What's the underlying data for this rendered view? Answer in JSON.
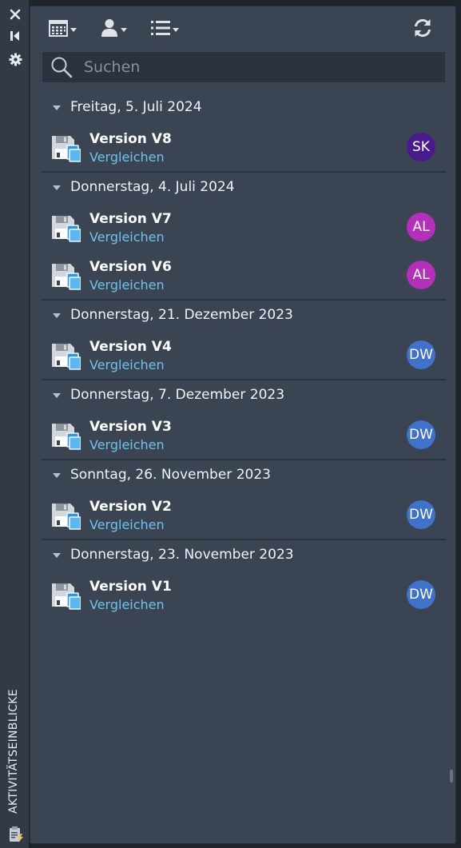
{
  "sidebar": {
    "title": "AKTIVITÄTSEINBLICKE",
    "icons": [
      "close-icon",
      "collapse-icon",
      "gear-icon",
      "clipboard-lightning-icon"
    ]
  },
  "toolbar": {
    "icons": [
      "calendar-filter-icon",
      "user-filter-icon",
      "list-filter-icon",
      "refresh-icon"
    ]
  },
  "search": {
    "placeholder": "Suchen",
    "value": ""
  },
  "colors": {
    "link": "#6fc4ef",
    "avatar_SK": "#4a1a8c",
    "avatar_AL": "#b530b8",
    "avatar_DW": "#3f72c8",
    "panel": "#3b4453"
  },
  "groups": [
    {
      "label": "Freitag, 5. Juli 2024",
      "items": [
        {
          "title": "Version V8",
          "link": "Vergleichen",
          "initials": "SK",
          "avatar_color": "#4a1a8c"
        }
      ]
    },
    {
      "label": "Donnerstag, 4. Juli 2024",
      "items": [
        {
          "title": "Version V7",
          "link": "Vergleichen",
          "initials": "AL",
          "avatar_color": "#b530b8"
        },
        {
          "title": "Version V6",
          "link": "Vergleichen",
          "initials": "AL",
          "avatar_color": "#b530b8"
        }
      ]
    },
    {
      "label": "Donnerstag, 21. Dezember 2023",
      "items": [
        {
          "title": "Version V4",
          "link": "Vergleichen",
          "initials": "DW",
          "avatar_color": "#3f72c8"
        }
      ]
    },
    {
      "label": "Donnerstag, 7. Dezember 2023",
      "items": [
        {
          "title": "Version V3",
          "link": "Vergleichen",
          "initials": "DW",
          "avatar_color": "#3f72c8"
        }
      ]
    },
    {
      "label": "Sonntag, 26. November 2023",
      "items": [
        {
          "title": "Version V2",
          "link": "Vergleichen",
          "initials": "DW",
          "avatar_color": "#3f72c8"
        }
      ]
    },
    {
      "label": "Donnerstag, 23. November 2023",
      "items": [
        {
          "title": "Version V1",
          "link": "Vergleichen",
          "initials": "DW",
          "avatar_color": "#3f72c8"
        }
      ]
    }
  ]
}
